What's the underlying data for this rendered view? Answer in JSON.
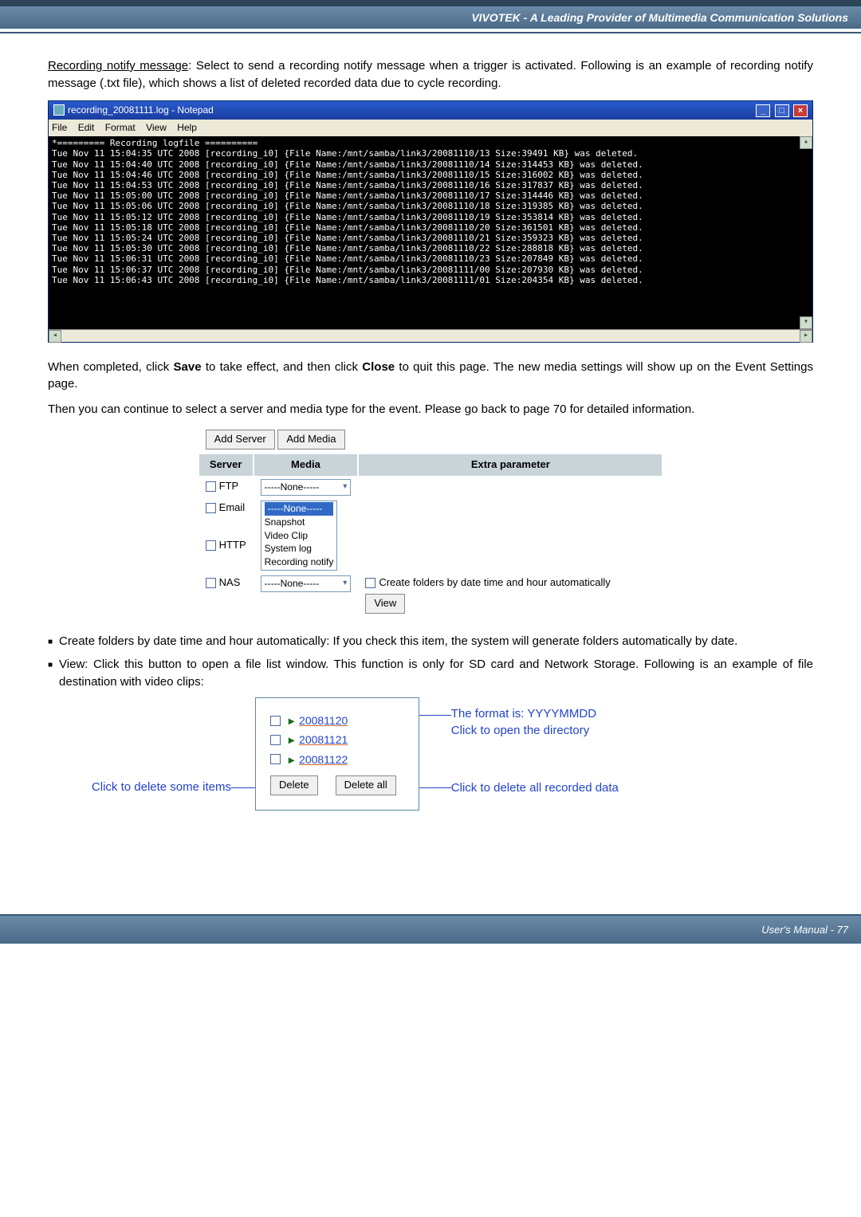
{
  "header_title": "VIVOTEK - A Leading Provider of Multimedia Communication Solutions",
  "section1": {
    "lead_label": "Recording notify message",
    "lead_rest": ": Select to send a recording notify message when a trigger is activated. Following is an example of recording notify message (.txt file), which shows a list of deleted recorded data due to cycle recording."
  },
  "notepad": {
    "title": "recording_20081111.log - Notepad",
    "menu": [
      "File",
      "Edit",
      "Format",
      "View",
      "Help"
    ],
    "header_line": "*========= Recording logfile ==========",
    "rows": [
      {
        "ts": "Tue Nov 11 15:04:35 UTC 2008",
        "tag": "[recording_i0]",
        "path": "/mnt/samba/link3/20081110/13",
        "size": "39491",
        "suffix": "was deleted."
      },
      {
        "ts": "Tue Nov 11 15:04:40 UTC 2008",
        "tag": "[recording_i0]",
        "path": "/mnt/samba/link3/20081110/14",
        "size": "314453",
        "suffix": "was deleted."
      },
      {
        "ts": "Tue Nov 11 15:04:46 UTC 2008",
        "tag": "[recording_i0]",
        "path": "/mnt/samba/link3/20081110/15",
        "size": "316002",
        "suffix": "was deleted."
      },
      {
        "ts": "Tue Nov 11 15:04:53 UTC 2008",
        "tag": "[recording_i0]",
        "path": "/mnt/samba/link3/20081110/16",
        "size": "317837",
        "suffix": "was deleted."
      },
      {
        "ts": "Tue Nov 11 15:05:00 UTC 2008",
        "tag": "[recording_i0]",
        "path": "/mnt/samba/link3/20081110/17",
        "size": "314446",
        "suffix": "was deleted."
      },
      {
        "ts": "Tue Nov 11 15:05:06 UTC 2008",
        "tag": "[recording_i0]",
        "path": "/mnt/samba/link3/20081110/18",
        "size": "319385",
        "suffix": "was deleted."
      },
      {
        "ts": "Tue Nov 11 15:05:12 UTC 2008",
        "tag": "[recording_i0]",
        "path": "/mnt/samba/link3/20081110/19",
        "size": "353814",
        "suffix": "was deleted."
      },
      {
        "ts": "Tue Nov 11 15:05:18 UTC 2008",
        "tag": "[recording_i0]",
        "path": "/mnt/samba/link3/20081110/20",
        "size": "361501",
        "suffix": "was deleted."
      },
      {
        "ts": "Tue Nov 11 15:05:24 UTC 2008",
        "tag": "[recording_i0]",
        "path": "/mnt/samba/link3/20081110/21",
        "size": "359323",
        "suffix": "was deleted."
      },
      {
        "ts": "Tue Nov 11 15:05:30 UTC 2008",
        "tag": "[recording_i0]",
        "path": "/mnt/samba/link3/20081110/22",
        "size": "288818",
        "suffix": "was deleted."
      },
      {
        "ts": "Tue Nov 11 15:06:31 UTC 2008",
        "tag": "[recording_i0]",
        "path": "/mnt/samba/link3/20081110/23",
        "size": "207849",
        "suffix": "was deleted."
      },
      {
        "ts": "Tue Nov 11 15:06:37 UTC 2008",
        "tag": "[recording_i0]",
        "path": "/mnt/samba/link3/20081111/00",
        "size": "207930",
        "suffix": "was deleted."
      },
      {
        "ts": "Tue Nov 11 15:06:43 UTC 2008",
        "tag": "[recording_i0]",
        "path": "/mnt/samba/link3/20081111/01",
        "size": "204354",
        "suffix": "was deleted."
      }
    ]
  },
  "para2a": "When completed, click ",
  "para2_save": "Save",
  "para2b": " to take effect, and then click ",
  "para2_close": "Close",
  "para2c": " to quit this page. The new media settings will show up on the Event Settings page.",
  "para3": "Then you can continue to select a server and media type for the event. Please go back to page 70 for detailed information.",
  "media_panel": {
    "add_server": "Add Server",
    "add_media": "Add Media",
    "col_server": "Server",
    "col_media": "Media",
    "col_extra": "Extra parameter",
    "rows": {
      "ftp": {
        "label": "FTP",
        "media": "-----None-----"
      },
      "email": {
        "label": "Email",
        "sel": "-----None-----",
        "opts": [
          "Snapshot",
          "Video Clip"
        ]
      },
      "http": {
        "label": "HTTP",
        "opts": [
          "System log",
          "Recording notify"
        ]
      },
      "nas": {
        "label": "NAS",
        "media": "-----None-----",
        "extra_check": "Create folders by date time and hour automatically",
        "view_btn": "View"
      }
    }
  },
  "bullet1_pre": "Create folders by date time and hour automatically: If you check this item, the system will generate folders automatically by date.",
  "bullet2_pre": "View: Click this button to open a file list window. This function is only for SD card and Network Storage. Following is an example of file destination with video clips:",
  "dirbox": {
    "links": [
      "20081120",
      "20081121",
      "20081122"
    ],
    "delete": "Delete",
    "delete_all": "Delete all"
  },
  "callout_right1": "The format is: YYYYMMDD",
  "callout_right2": "Click to open the directory",
  "callout_left": "Click to delete some items",
  "callout_right3": "Click to delete all recorded data",
  "footer": "User's Manual - 77"
}
